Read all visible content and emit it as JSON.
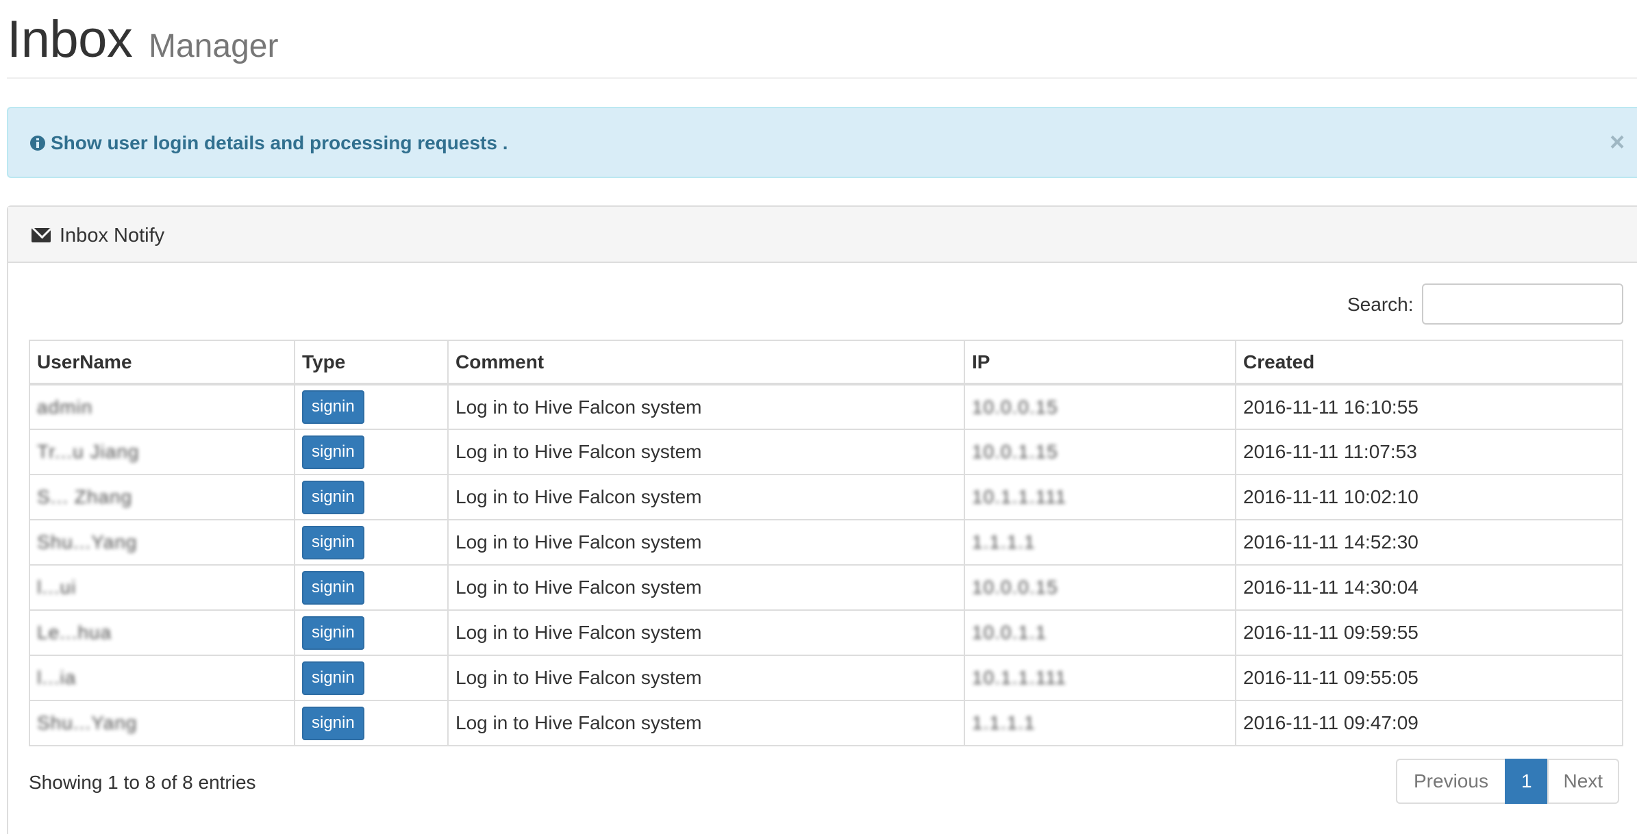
{
  "header": {
    "title": "Inbox",
    "subtitle": "Manager"
  },
  "alert": {
    "icon": "info-circle-icon",
    "message": "Show user login details and processing requests .",
    "close": "×"
  },
  "panel": {
    "icon": "envelope-icon",
    "title": "Inbox Notify"
  },
  "search": {
    "label": "Search:",
    "value": "",
    "placeholder": ""
  },
  "table": {
    "columns": [
      "UserName",
      "Type",
      "Comment",
      "IP",
      "Created"
    ],
    "rows": [
      {
        "username": "admin",
        "type": "signin",
        "comment": "Log in to Hive Falcon system",
        "ip": "10.0.0.15",
        "created": "2016-11-11 16:10:55"
      },
      {
        "username": "Tr...u Jiang",
        "type": "signin",
        "comment": "Log in to Hive Falcon system",
        "ip": "10.0.1.15",
        "created": "2016-11-11 11:07:53"
      },
      {
        "username": "S... Zhang",
        "type": "signin",
        "comment": "Log in to Hive Falcon system",
        "ip": "10.1.1.111",
        "created": "2016-11-11 10:02:10"
      },
      {
        "username": "Shu...Yang",
        "type": "signin",
        "comment": "Log in to Hive Falcon system",
        "ip": "1.1.1.1",
        "created": "2016-11-11 14:52:30"
      },
      {
        "username": "l...ui",
        "type": "signin",
        "comment": "Log in to Hive Falcon system",
        "ip": "10.0.0.15",
        "created": "2016-11-11 14:30:04"
      },
      {
        "username": "Le...hua",
        "type": "signin",
        "comment": "Log in to Hive Falcon system",
        "ip": "10.0.1.1",
        "created": "2016-11-11 09:59:55"
      },
      {
        "username": "l...ia",
        "type": "signin",
        "comment": "Log in to Hive Falcon system",
        "ip": "10.1.1.111",
        "created": "2016-11-11 09:55:05"
      },
      {
        "username": "Shu...Yang",
        "type": "signin",
        "comment": "Log in to Hive Falcon system",
        "ip": "1.1.1.1",
        "created": "2016-11-11 09:47:09"
      }
    ]
  },
  "footer": {
    "info": "Showing 1 to 8 of 8 entries",
    "pagination": {
      "previous": "Previous",
      "current": "1",
      "next": "Next"
    }
  },
  "colors": {
    "primary": "#337ab7",
    "alert_bg": "#d9edf7",
    "alert_text": "#31708f"
  }
}
